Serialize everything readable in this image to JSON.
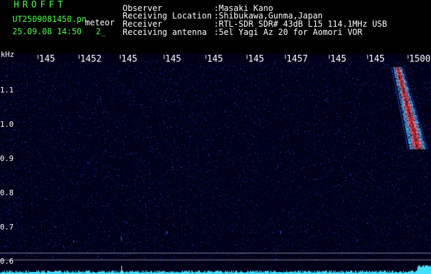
{
  "header": {
    "app_title": "HROFFT",
    "file_name": "UT2509081450.pn",
    "mode": "meteor",
    "date_time": "25.09.08 14:50",
    "page": "2_"
  },
  "station": {
    "observer_label": "Observer",
    "observer_value": ":Masaki Kano",
    "location_label": "Receiving Location",
    "location_value": ":Shibukawa,Gunma,Japan",
    "receiver_label": "Receiver",
    "receiver_value": ":RTL-SDR SDR# 43dB L15 114.1MHz USB",
    "antenna_label": "Receiving antenna",
    "antenna_value": ":5el Yagi Az 20 for Aomori VOR"
  },
  "spectrogram": {
    "y_unit": "kHz",
    "y_ticks": [
      "1.1",
      "1.0",
      "0.9",
      "0.8",
      "0.7",
      "0.6"
    ],
    "time_labels": [
      "145",
      "1452",
      "145",
      "145",
      "145",
      "145",
      "1457",
      "145",
      "145",
      "1500"
    ],
    "colors": {
      "background": "#000018",
      "noise": "#2a3cc8",
      "signal_core": "#ff3030",
      "signal_edge": "#40c0ff",
      "baseline": "#40e0ff"
    }
  }
}
